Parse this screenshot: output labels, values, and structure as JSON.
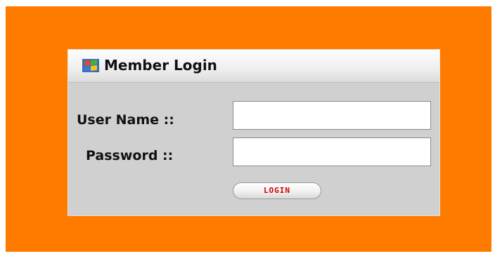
{
  "login_panel": {
    "title": "Member Login",
    "icon": "windows-logo-icon",
    "username_label": "User Name ::",
    "username_value": "",
    "password_label": "Password ::",
    "password_value": "",
    "login_button_label": "LOGIN"
  },
  "colors": {
    "page_background": "#ff7b00",
    "panel_background": "#d0d0d0",
    "button_text": "#d40000"
  }
}
